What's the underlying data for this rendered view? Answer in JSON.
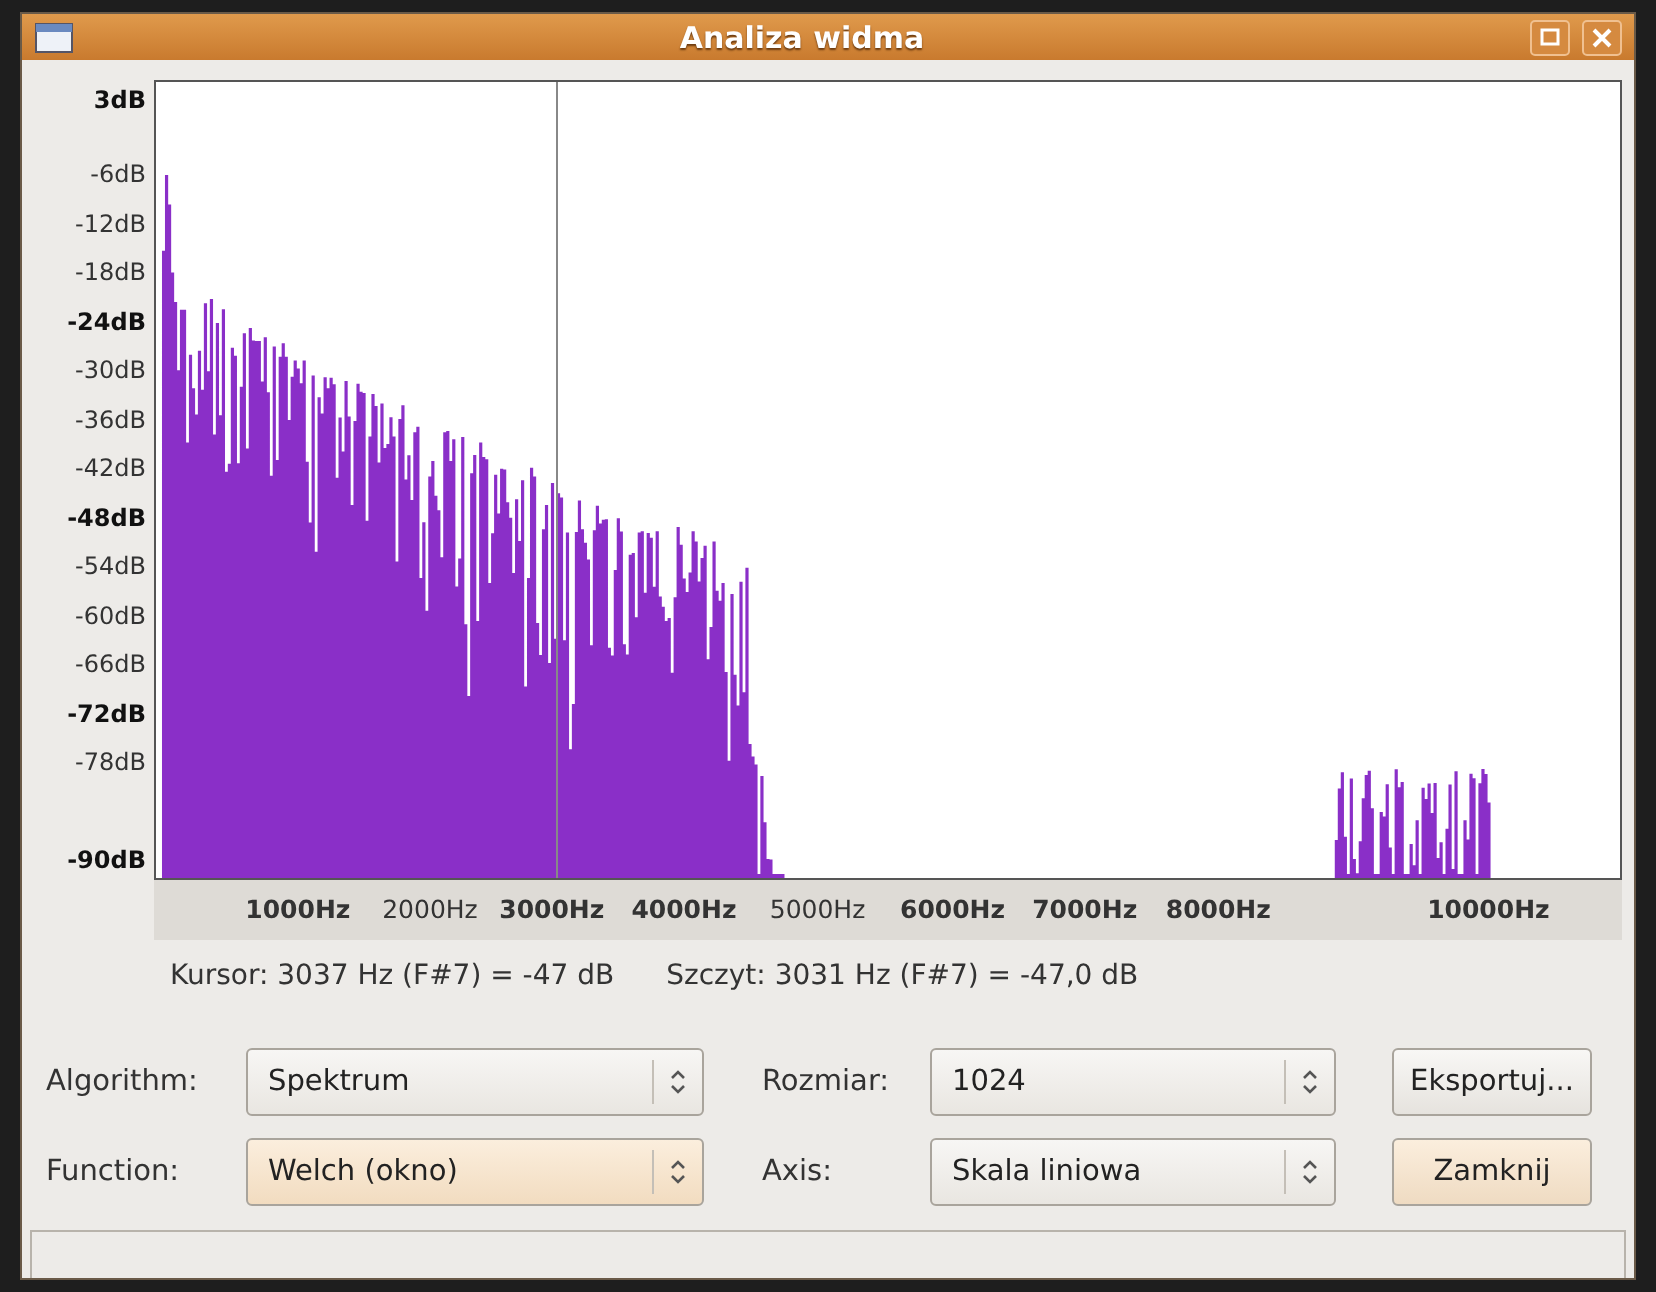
{
  "window": {
    "title": "Analiza widma"
  },
  "plot": {
    "y_labels": [
      {
        "text": "3dB",
        "bold": true
      },
      {
        "text": "-6dB",
        "bold": false
      },
      {
        "text": "-12dB",
        "bold": false
      },
      {
        "text": "-18dB",
        "bold": false
      },
      {
        "text": "-24dB",
        "bold": true
      },
      {
        "text": "-30dB",
        "bold": false
      },
      {
        "text": "-36dB",
        "bold": false
      },
      {
        "text": "-42dB",
        "bold": false
      },
      {
        "text": "-48dB",
        "bold": true
      },
      {
        "text": "-54dB",
        "bold": false
      },
      {
        "text": "-60dB",
        "bold": false
      },
      {
        "text": "-66dB",
        "bold": false
      },
      {
        "text": "-72dB",
        "bold": true
      },
      {
        "text": "-78dB",
        "bold": false
      },
      {
        "text": "-90dB",
        "bold": true
      }
    ],
    "x_labels": [
      {
        "text": "1000Hz",
        "bold": true
      },
      {
        "text": "2000Hz",
        "bold": false
      },
      {
        "text": "3000Hz",
        "bold": true
      },
      {
        "text": "4000Hz",
        "bold": true
      },
      {
        "text": "5000Hz",
        "bold": false
      },
      {
        "text": "6000Hz",
        "bold": true
      },
      {
        "text": "7000Hz",
        "bold": true
      },
      {
        "text": "8000Hz",
        "bold": true
      },
      {
        "text": "10000Hz",
        "bold": true
      }
    ]
  },
  "readout": {
    "cursor": "Kursor: 3037 Hz (F#7) = -47 dB",
    "peak": "Szczyt: 3031 Hz (F#7) = -47,0 dB"
  },
  "rows": [
    {
      "fields": [
        {
          "label": "Algorithm:",
          "value": "Spektrum",
          "focused": false
        },
        {
          "label": "Rozmiar:",
          "value": "1024",
          "focused": false
        }
      ],
      "button": {
        "label": "Eksportuj...",
        "default": false
      }
    },
    {
      "fields": [
        {
          "label": "Function:",
          "value": "Welch (okno)",
          "focused": true
        },
        {
          "label": "Axis:",
          "value": "Skala liniowa",
          "focused": false
        }
      ],
      "button": {
        "label": "Zamknij",
        "default": true
      }
    }
  ]
}
